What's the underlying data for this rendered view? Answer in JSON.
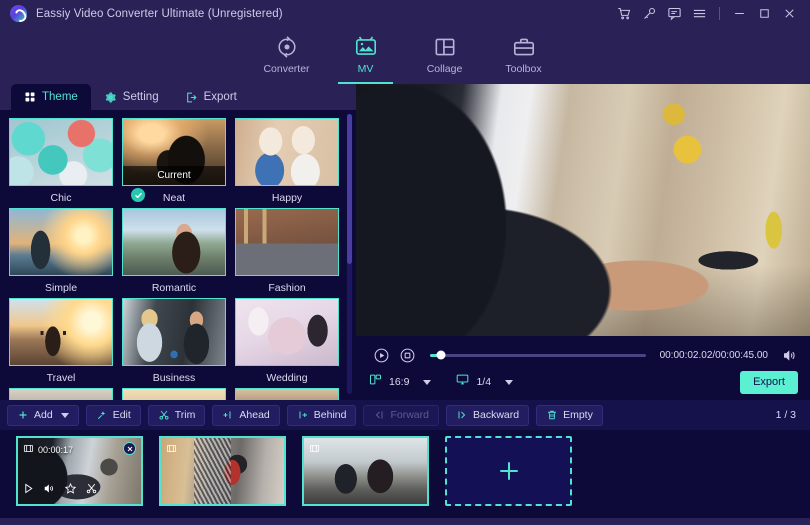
{
  "window": {
    "title": "Eassiy Video Converter Ultimate (Unregistered)",
    "logo_icon": "app-logo-icon",
    "controls": [
      {
        "name": "cart-icon",
        "label": "Cart"
      },
      {
        "name": "key-icon",
        "label": "Register"
      },
      {
        "name": "feedback-icon",
        "label": "Feedback"
      },
      {
        "name": "menu-icon",
        "label": "Menu"
      },
      {
        "name": "minimize-icon",
        "label": "Minimize"
      },
      {
        "name": "maximize-icon",
        "label": "Maximize"
      },
      {
        "name": "close-icon",
        "label": "Close"
      }
    ]
  },
  "mainnav": {
    "items": [
      {
        "label": "Converter",
        "icon": "converter-icon",
        "active": false
      },
      {
        "label": "MV",
        "icon": "mv-icon",
        "active": true
      },
      {
        "label": "Collage",
        "icon": "collage-icon",
        "active": false
      },
      {
        "label": "Toolbox",
        "icon": "toolbox-icon",
        "active": false
      }
    ]
  },
  "subtabs": {
    "items": [
      {
        "label": "Theme",
        "icon": "grid-icon",
        "active": true
      },
      {
        "label": "Setting",
        "icon": "gear-icon",
        "active": false
      },
      {
        "label": "Export",
        "icon": "export-icon",
        "active": false
      }
    ]
  },
  "themes": {
    "current_badge": "Current",
    "items": [
      {
        "label": "Chic",
        "selected": false
      },
      {
        "label": "Neat",
        "selected": true
      },
      {
        "label": "Happy",
        "selected": false
      },
      {
        "label": "Simple",
        "selected": false
      },
      {
        "label": "Romantic",
        "selected": false
      },
      {
        "label": "Fashion",
        "selected": false
      },
      {
        "label": "Travel",
        "selected": false
      },
      {
        "label": "Business",
        "selected": false
      },
      {
        "label": "Wedding",
        "selected": false
      }
    ]
  },
  "preview": {
    "play_icon": "play-icon",
    "stop_icon": "stop-icon",
    "volume_icon": "volume-icon",
    "time": "00:00:02.02/00:00:45.00",
    "progress_percent": 5,
    "aspect_icon": "aspect-ratio-icon",
    "aspect_value": "16:9",
    "quality_icon": "screen-icon",
    "quality_value": "1/4",
    "export_label": "Export"
  },
  "toolbar": {
    "buttons": [
      {
        "label": "Add",
        "icon": "plus-icon",
        "dropdown": true,
        "disabled": false
      },
      {
        "label": "Edit",
        "icon": "magic-wand-icon",
        "dropdown": false,
        "disabled": false
      },
      {
        "label": "Trim",
        "icon": "scissors-icon",
        "dropdown": false,
        "disabled": false
      },
      {
        "label": "Ahead",
        "icon": "insert-ahead-icon",
        "dropdown": false,
        "disabled": false
      },
      {
        "label": "Behind",
        "icon": "insert-behind-icon",
        "dropdown": false,
        "disabled": false
      },
      {
        "label": "Forward",
        "icon": "move-forward-icon",
        "dropdown": false,
        "disabled": true
      },
      {
        "label": "Backward",
        "icon": "move-backward-icon",
        "dropdown": false,
        "disabled": false
      },
      {
        "label": "Empty",
        "icon": "trash-icon",
        "dropdown": false,
        "disabled": false
      }
    ],
    "page_indicator": "1 / 3"
  },
  "timeline": {
    "clips": [
      {
        "duration": "00:00:17",
        "selected": true
      },
      {
        "duration": "",
        "selected": false
      },
      {
        "duration": "",
        "selected": false
      }
    ],
    "clip_tools": [
      "play-icon",
      "volume-icon",
      "effect-icon",
      "scissors-icon"
    ],
    "close_icon": "close-icon",
    "film-icon": "film-icon",
    "add_clip_icon": "plus-icon"
  },
  "colors": {
    "accent": "#4fe3d0",
    "chrome": "#2a2156",
    "background": "#0d0a3a",
    "export": "#5cf0d2"
  }
}
